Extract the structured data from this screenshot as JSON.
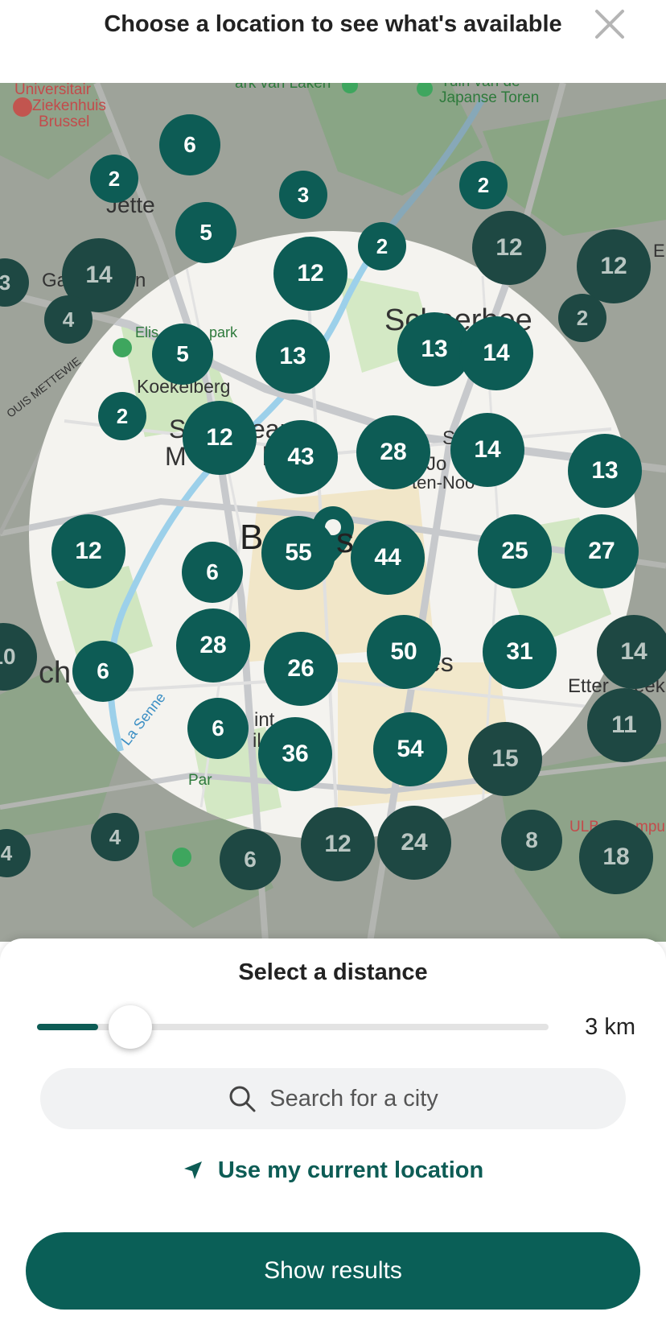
{
  "header": {
    "title": "Choose a location to see what's available",
    "close_icon": "close-icon"
  },
  "map": {
    "labels": [
      "Universitair",
      "Ziekenhuis",
      "Brussel",
      "ark van Laken",
      "Tuin van de",
      "Japanse Toren",
      "Jette",
      "Ga",
      "n",
      "Elis",
      "park",
      "Schaerbee",
      "E",
      "Koekelberg",
      "S",
      "ean",
      "M",
      "b",
      "S",
      "Jo",
      "ten-Noo",
      "B",
      "s",
      "ch",
      "es",
      "Etter",
      "eek",
      "La Senne",
      "int",
      "il",
      "Par",
      "ULB",
      "mpu",
      "OUIS METTEWIE"
    ],
    "clusters": [
      {
        "label": "6"
      },
      {
        "label": "2"
      },
      {
        "label": "3"
      },
      {
        "label": "5"
      },
      {
        "label": "2"
      },
      {
        "label": "2"
      },
      {
        "label": "12"
      },
      {
        "label": "12"
      },
      {
        "label": "14"
      },
      {
        "label": "3"
      },
      {
        "label": "4"
      },
      {
        "label": "12"
      },
      {
        "label": "2"
      },
      {
        "label": "5"
      },
      {
        "label": "13"
      },
      {
        "label": "13"
      },
      {
        "label": "14"
      },
      {
        "label": "2"
      },
      {
        "label": "12"
      },
      {
        "label": "43"
      },
      {
        "label": "28"
      },
      {
        "label": "14"
      },
      {
        "label": "13"
      },
      {
        "label": "12"
      },
      {
        "label": "6"
      },
      {
        "label": "55"
      },
      {
        "label": "44"
      },
      {
        "label": "25"
      },
      {
        "label": "27"
      },
      {
        "label": "10"
      },
      {
        "label": "6"
      },
      {
        "label": "28"
      },
      {
        "label": "26"
      },
      {
        "label": "50"
      },
      {
        "label": "31"
      },
      {
        "label": "14"
      },
      {
        "label": "6"
      },
      {
        "label": "36"
      },
      {
        "label": "54"
      },
      {
        "label": "15"
      },
      {
        "label": "11"
      },
      {
        "label": "4"
      },
      {
        "label": "4"
      },
      {
        "label": "6"
      },
      {
        "label": "12"
      },
      {
        "label": "24"
      },
      {
        "label": "8"
      },
      {
        "label": "18"
      }
    ],
    "search_radius_km": 3,
    "accent_color": "#0d5c55"
  },
  "sheet": {
    "title": "Select a distance",
    "distance_value": "3 km",
    "slider_fraction": 0.12,
    "search_placeholder": "Search for a city",
    "search_icon": "search-icon",
    "use_location_label": "Use my current location",
    "use_location_icon": "navigation-arrow-icon",
    "show_results_label": "Show results"
  }
}
